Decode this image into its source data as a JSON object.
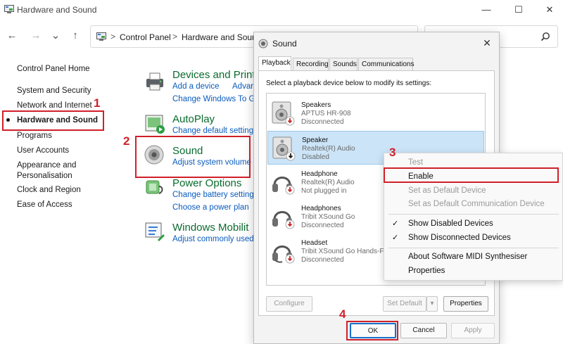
{
  "window": {
    "title": "Hardware and Sound",
    "caption_min": "—",
    "caption_max": "☐",
    "caption_close": "✕"
  },
  "nav": {
    "back": "←",
    "forward": "→",
    "recent": "⌄",
    "up": "↑",
    "breadcrumb": [
      "Control Panel",
      "Hardware and Sound"
    ],
    "separator": ">",
    "search_icon": "search-icon"
  },
  "left_nav": {
    "items": [
      "Control Panel Home",
      "System and Security",
      "Network and Internet",
      "Hardware and Sound",
      "Programs",
      "User Accounts",
      "Appearance and",
      "Personalisation",
      "Clock and Region",
      "Ease of Access"
    ],
    "active": "Hardware and Sound"
  },
  "categories": [
    {
      "title": "Devices and Print",
      "links": [
        "Add a device",
        "Advar",
        "Change Windows To G"
      ],
      "icon": "printer-icon"
    },
    {
      "title": "AutoPlay",
      "links": [
        "Change default setting"
      ],
      "icon": "autoplay-icon"
    },
    {
      "title": "Sound",
      "links": [
        "Adjust system volume"
      ],
      "icon": "speaker-icon"
    },
    {
      "title": "Power Options",
      "links": [
        "Change battery setting",
        "Choose a power plan"
      ],
      "icon": "power-icon"
    },
    {
      "title": "Windows Mobilit",
      "links": [
        "Adjust commonly used"
      ],
      "icon": "mobility-icon"
    }
  ],
  "annotations": [
    "1",
    "2",
    "3",
    "4"
  ],
  "dialog": {
    "title": "Sound",
    "close": "✕",
    "tabs": [
      "Playback",
      "Recording",
      "Sounds",
      "Communications"
    ],
    "active_tab": "Playback",
    "instruction": "Select a playback device below to modify its settings:",
    "devices": [
      {
        "name": "Speakers",
        "driver": "APTUS HR-908",
        "status": "Disconnected",
        "icon": "speaker-device-icon"
      },
      {
        "name": "Speaker",
        "driver": "Realtek(R) Audio",
        "status": "Disabled",
        "icon": "speaker-device-icon",
        "selected": true
      },
      {
        "name": "Headphone",
        "driver": "Realtek(R) Audio",
        "status": "Not plugged in",
        "icon": "headphone-icon"
      },
      {
        "name": "Headphones",
        "driver": "Tribit XSound Go",
        "status": "Disconnected",
        "icon": "headphone-icon"
      },
      {
        "name": "Headset",
        "driver": "Tribit XSound Go Hands-Fr",
        "status": "Disconnected",
        "icon": "headphone-icon"
      }
    ],
    "buttons": {
      "configure": "Configure",
      "set_default": "Set Default",
      "set_default_arrow": "▾",
      "properties": "Properties",
      "ok": "OK",
      "cancel": "Cancel",
      "apply": "Apply"
    }
  },
  "context_menu": {
    "items": [
      {
        "label": "Test",
        "enabled": false,
        "checked": false
      },
      {
        "label": "Enable",
        "enabled": true,
        "checked": false
      },
      {
        "label": "Set as Default Device",
        "enabled": false,
        "checked": false
      },
      {
        "label": "Set as Default Communication Device",
        "enabled": false,
        "checked": false
      },
      {
        "label": "Show Disabled Devices",
        "enabled": true,
        "checked": true
      },
      {
        "label": "Show Disconnected Devices",
        "enabled": true,
        "checked": true
      },
      {
        "label": "About Software MIDI Synthesiser",
        "enabled": true,
        "checked": false
      },
      {
        "label": "Properties",
        "enabled": true,
        "checked": false
      }
    ],
    "check_glyph": "✓"
  },
  "colors": {
    "annotation": "#d0202a",
    "link": "#0a5bbd",
    "category_title": "#0a6b2e",
    "selection": "#cce4f7"
  }
}
